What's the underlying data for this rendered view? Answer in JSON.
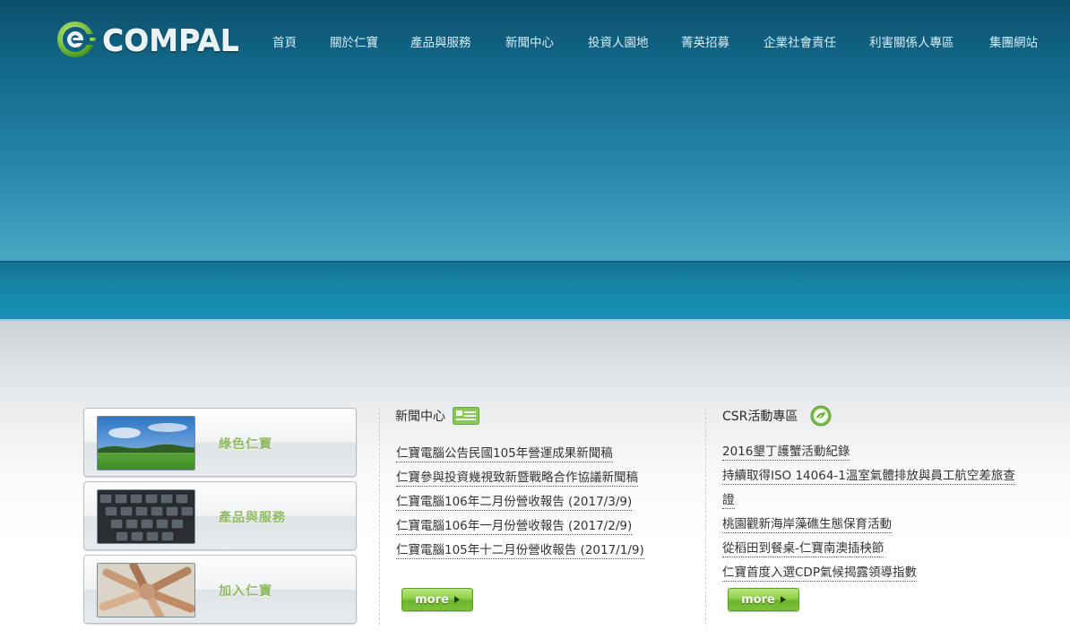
{
  "brand": {
    "name": "COMPAL",
    "logo_icon": "compal-swirl-icon",
    "color": "#7ac143"
  },
  "nav": {
    "items": [
      {
        "label": "首頁"
      },
      {
        "label": "關於仁寶"
      },
      {
        "label": "產品與服務"
      },
      {
        "label": "新聞中心"
      },
      {
        "label": "投資人園地"
      },
      {
        "label": "菁英招募"
      },
      {
        "label": "企業社會責任"
      },
      {
        "label": "利害關係人專區"
      },
      {
        "label": "集團網站"
      }
    ]
  },
  "promos": [
    {
      "label": "綠色仁寶",
      "thumb": "green-field-image"
    },
    {
      "label": "產品與服務",
      "thumb": "keyboard-image"
    },
    {
      "label": "加入仁寶",
      "thumb": "team-hands-image"
    }
  ],
  "news": {
    "title": "新聞中心",
    "icon": "news-card-icon",
    "items": [
      "仁寶電腦公告民國105年營運成果新聞稿",
      "仁寶參與投資幾視致新暨戰略合作協議新聞稿",
      "仁寶電腦106年二月份營收報告 (2017/3/9)",
      "仁寶電腦106年一月份營收報告 (2017/2/9)",
      "仁寶電腦105年十二月份營收報告 (2017/1/9)"
    ],
    "more_label": "more"
  },
  "csr": {
    "title": "CSR活動專區",
    "icon": "leaf-globe-icon",
    "items": [
      "2016墾丁護蟹活動紀錄",
      "持續取得ISO 14064-1溫室氣體排放與員工航空差旅查證",
      "桃園觀新海岸藻礁生態保育活動",
      "從稻田到餐桌-仁寶南澳插秧節",
      "仁寶首度入選CDP氣候揭露領導指數"
    ],
    "more_label": "more"
  }
}
